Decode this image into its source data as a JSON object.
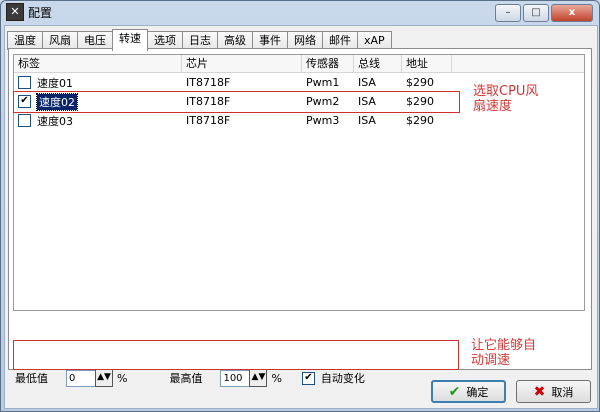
{
  "window": {
    "title": "配置",
    "icon": "app-config-icon",
    "controls": {
      "minimize": "–",
      "maximize": "□",
      "close": "x"
    }
  },
  "tabs": [
    {
      "label": "温度"
    },
    {
      "label": "风扇"
    },
    {
      "label": "电压"
    },
    {
      "label": "转速",
      "active": true
    },
    {
      "label": "选项"
    },
    {
      "label": "日志"
    },
    {
      "label": "高级"
    },
    {
      "label": "事件"
    },
    {
      "label": "网络"
    },
    {
      "label": "邮件"
    },
    {
      "label": "xAP"
    }
  ],
  "table": {
    "headers": [
      "标签",
      "芯片",
      "传感器",
      "总线",
      "地址"
    ],
    "rows": [
      {
        "checked": false,
        "label": "速度01",
        "chip": "IT8718F",
        "sensor": "Pwm1",
        "bus": "ISA",
        "address": "$290"
      },
      {
        "checked": true,
        "label": "速度02",
        "chip": "IT8718F",
        "sensor": "Pwm2",
        "bus": "ISA",
        "address": "$290",
        "selected": true
      },
      {
        "checked": false,
        "label": "速度03",
        "chip": "IT8718F",
        "sensor": "Pwm3",
        "bus": "ISA",
        "address": "$290"
      }
    ]
  },
  "annotations": {
    "select_cpu_fan_line1": "选取CPU风",
    "select_cpu_fan_line2": "扇速度",
    "auto_adjust_line1": "让它能够自",
    "auto_adjust_line2": "动调速"
  },
  "bottom": {
    "min_label": "最低值",
    "min_value": "0",
    "min_unit": "%",
    "max_label": "最高值",
    "max_value": "100",
    "max_unit": "%",
    "auto_label": "自动变化",
    "auto_checked": true
  },
  "buttons": {
    "ok": "确定",
    "cancel": "取消"
  },
  "colors": {
    "annotation": "#d63636",
    "selection": "#0a246a"
  }
}
